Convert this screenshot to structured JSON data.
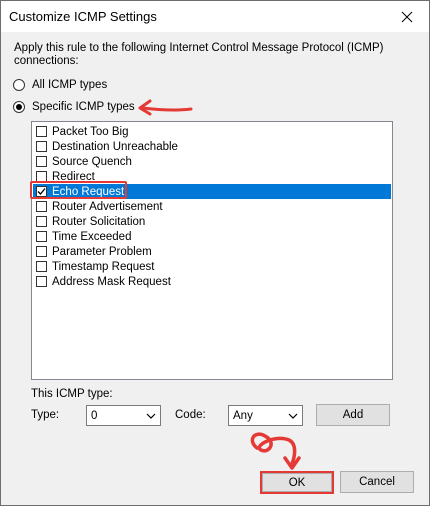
{
  "window": {
    "title": "Customize ICMP Settings"
  },
  "intro": "Apply this rule to the following Internet Control Message Protocol (ICMP) connections:",
  "radios": {
    "all_label": "All ICMP types",
    "specific_label": "Specific ICMP types",
    "selected": "specific"
  },
  "icmp_types": [
    {
      "label": "Packet Too Big",
      "checked": false,
      "selected": false
    },
    {
      "label": "Destination Unreachable",
      "checked": false,
      "selected": false
    },
    {
      "label": "Source Quench",
      "checked": false,
      "selected": false
    },
    {
      "label": "Redirect",
      "checked": false,
      "selected": false
    },
    {
      "label": "Echo Request",
      "checked": true,
      "selected": true
    },
    {
      "label": "Router Advertisement",
      "checked": false,
      "selected": false
    },
    {
      "label": "Router Solicitation",
      "checked": false,
      "selected": false
    },
    {
      "label": "Time Exceeded",
      "checked": false,
      "selected": false
    },
    {
      "label": "Parameter Problem",
      "checked": false,
      "selected": false
    },
    {
      "label": "Timestamp Request",
      "checked": false,
      "selected": false
    },
    {
      "label": "Address Mask Request",
      "checked": false,
      "selected": false
    }
  ],
  "this_type": {
    "section_label": "This ICMP type:",
    "type_label": "Type:",
    "type_value": "0",
    "code_label": "Code:",
    "code_value": "Any",
    "add_label": "Add"
  },
  "buttons": {
    "ok_label": "OK",
    "cancel_label": "Cancel"
  },
  "colors": {
    "selection": "#0078d7",
    "annotation": "#e53935"
  }
}
